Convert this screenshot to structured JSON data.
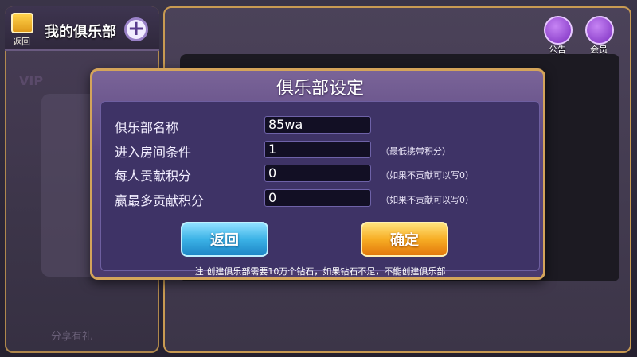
{
  "left": {
    "back_label": "返回",
    "title": "我的俱乐部",
    "plus_symbol": "+",
    "vip": "VIP",
    "share": "分享有礼"
  },
  "top_icons": {
    "notice": "公告",
    "member": "会员"
  },
  "dialog": {
    "title": "俱乐部设定",
    "fields": [
      {
        "label": "俱乐部名称",
        "value": "85wa",
        "hint": ""
      },
      {
        "label": "进入房间条件",
        "value": "1",
        "hint": "（最低携带积分）"
      },
      {
        "label": "每人贡献积分",
        "value": "0",
        "hint": "（如果不贡献可以写0）"
      },
      {
        "label": "赢最多贡献积分",
        "value": "0",
        "hint": "（如果不贡献可以写0）"
      }
    ],
    "back_button": "返回",
    "ok_button": "确定",
    "note": "注:创建俱乐部需要10万个钻石，如果钻石不足，不能创建俱乐部"
  }
}
